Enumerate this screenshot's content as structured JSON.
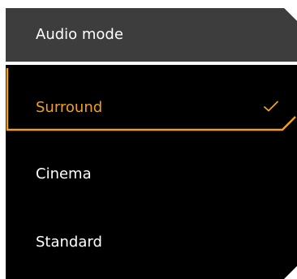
{
  "menu": {
    "title": "Audio mode",
    "selected_index": 0,
    "accent_color": "#f0a020",
    "items": [
      {
        "label": "Surround",
        "selected": true
      },
      {
        "label": "Cinema",
        "selected": false
      },
      {
        "label": "Standard",
        "selected": false
      }
    ],
    "check_icon": "checkmark-icon"
  }
}
